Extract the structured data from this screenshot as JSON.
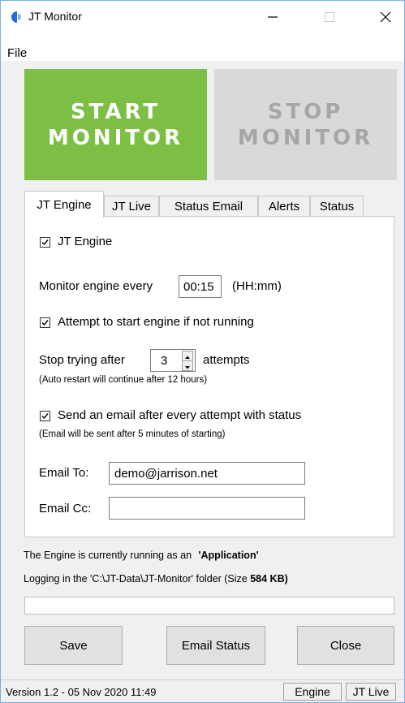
{
  "window": {
    "title": "JT Monitor",
    "controls": {
      "minimize": "—",
      "maximize": "☐",
      "close": "✕"
    }
  },
  "menu": {
    "file": "File"
  },
  "monitor_buttons": {
    "start": {
      "line1": "START",
      "line2": "MONITOR",
      "color": "#7dbf45"
    },
    "stop": {
      "line1": "STOP",
      "line2": "MONITOR",
      "color": "#d9d9d9"
    }
  },
  "tabs": [
    {
      "label": "JT Engine",
      "active": true
    },
    {
      "label": "JT Live",
      "active": false
    },
    {
      "label": "Status Email",
      "active": false
    },
    {
      "label": "Alerts",
      "active": false
    },
    {
      "label": "Status",
      "active": false
    }
  ],
  "engine_tab": {
    "jt_engine_checkbox": {
      "label": "JT Engine",
      "checked": true
    },
    "monitor_every": {
      "label": "Monitor engine every",
      "value": "00:15",
      "unit": "(HH:mm)"
    },
    "attempt_start_checkbox": {
      "label": "Attempt to start engine if not running",
      "checked": true
    },
    "stop_trying": {
      "label": "Stop trying after",
      "value": "3",
      "unit": "attempts"
    },
    "auto_restart_note": "(Auto restart will continue after 12 hours)",
    "send_email_checkbox": {
      "label": "Send an email after every attempt with status",
      "checked": true
    },
    "email_note": "(Email will be sent after 5 minutes of starting)",
    "email_to": {
      "label": "Email To:",
      "value": "demo@jarrison.net"
    },
    "email_cc": {
      "label": "Email Cc:",
      "value": ""
    }
  },
  "info": {
    "running_prefix": "The Engine is currently running as an",
    "running_mode": "'Application'",
    "logging_prefix": "Logging in the 'C:\\JT-Data\\JT-Monitor' folder (Size",
    "logging_size": "584 KB)"
  },
  "buttons": {
    "save": "Save",
    "email_status": "Email Status",
    "close": "Close"
  },
  "statusbar": {
    "version": "Version 1.2 - 05 Nov 2020 11:49",
    "engine": "Engine",
    "jt_live": "JT Live"
  },
  "icons": [
    "app-icon",
    "minimize-icon",
    "maximize-icon",
    "close-icon",
    "checkmark-icon",
    "spin-up-icon",
    "spin-down-icon"
  ]
}
